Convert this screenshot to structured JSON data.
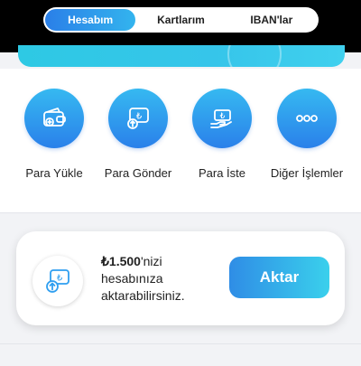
{
  "tabs": [
    {
      "label": "Hesabım",
      "active": true
    },
    {
      "label": "Kartlarım",
      "active": false
    },
    {
      "label": "IBAN'lar",
      "active": false
    }
  ],
  "actions": [
    {
      "label": "Para Yükle",
      "icon": "wallet-add-icon"
    },
    {
      "label": "Para Gönder",
      "icon": "lira-send-icon"
    },
    {
      "label": "Para İste",
      "icon": "hand-money-icon"
    },
    {
      "label": "Diğer İşlemler",
      "icon": "more-dots-icon"
    }
  ],
  "transfer_card": {
    "amount": "₺1.500",
    "suffix": "'nizi",
    "line2": "hesabınıza",
    "line3": "aktarabilirsiniz.",
    "button_label": "Aktar",
    "icon": "lira-transfer-icon"
  },
  "colors": {
    "accent_blue": "#2a80ea",
    "accent_cyan": "#36c5ea",
    "background": "#f2f3f6"
  }
}
